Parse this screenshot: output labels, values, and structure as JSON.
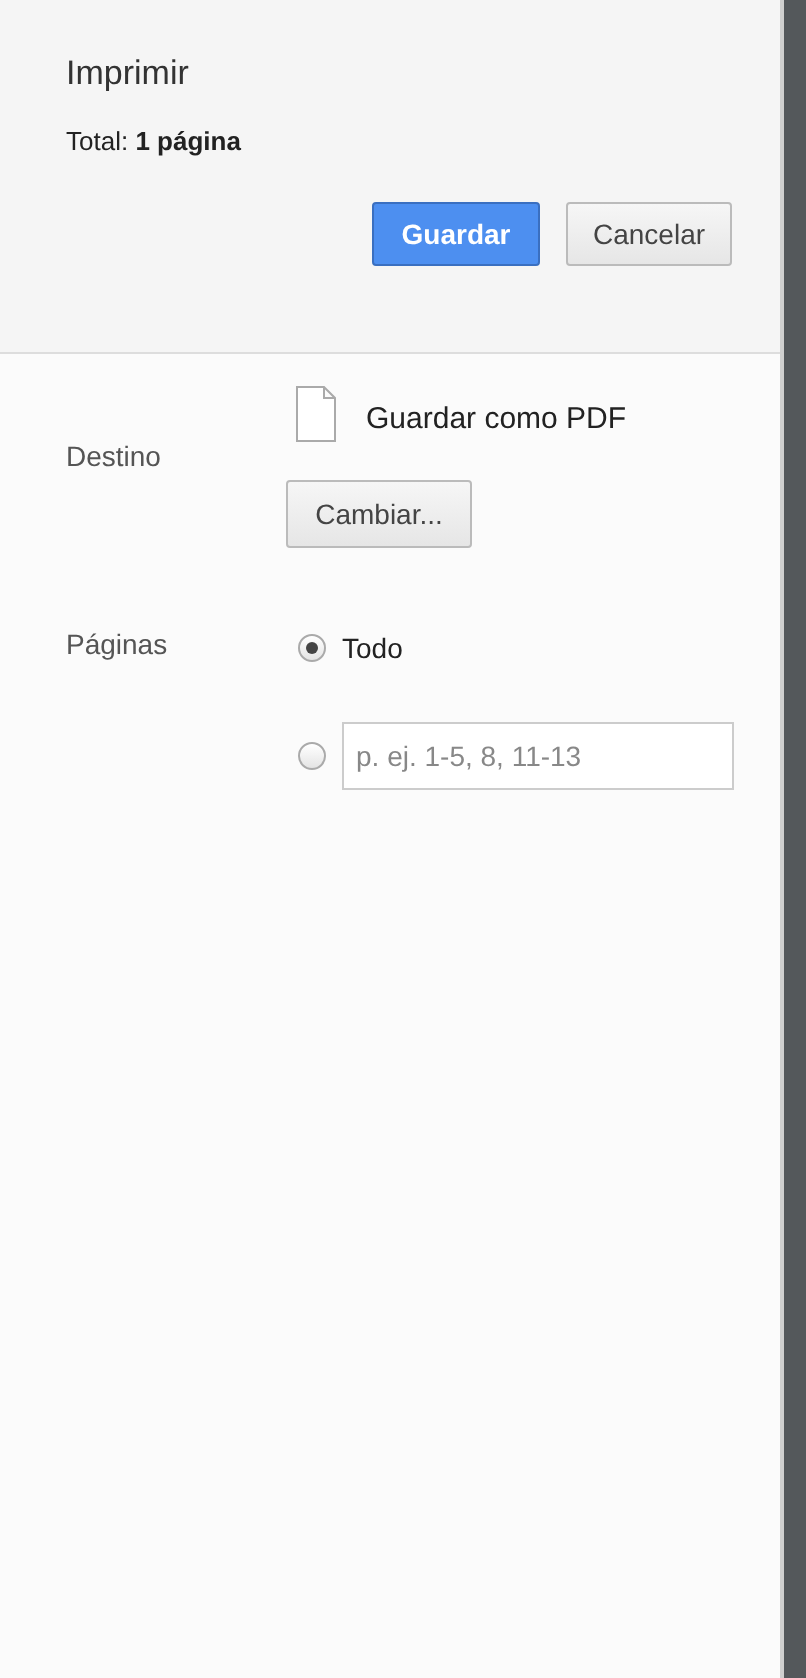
{
  "header": {
    "title": "Imprimir",
    "total": "Total: **1 página**",
    "buttons": [
      {
        "label": "Guardar",
        "kind": "primary"
      },
      {
        "label": "Cancelar",
        "kind": "secondary"
      }
    ]
  },
  "destination": {
    "label": "Destino",
    "printer": "Guardar como PDF",
    "change_button": "Cambiar..."
  },
  "pages": {
    "label": "Páginas",
    "options": [
      {
        "kind": "label",
        "label": "Todo",
        "selected": true
      },
      {
        "kind": "input",
        "placeholder": "p. ej. 1-5, 8, 11-13",
        "selected": false
      }
    ]
  }
}
